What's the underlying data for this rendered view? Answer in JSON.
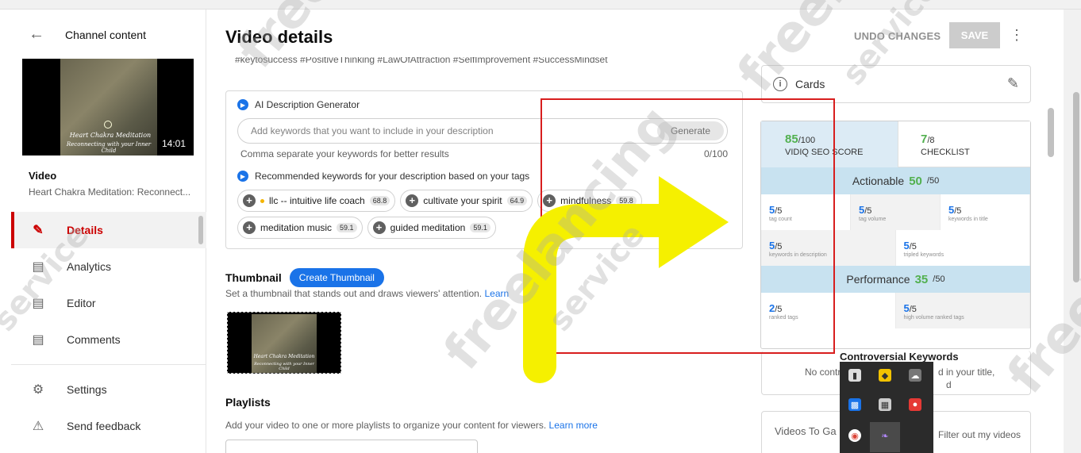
{
  "sidebar": {
    "header": "Channel content",
    "thumbnail": {
      "duration": "14:01",
      "line1": "Heart Chakra Meditation",
      "line2": "Reconnecting with your Inner Child"
    },
    "video_label": "Video",
    "video_title": "Heart Chakra Meditation: Reconnect...",
    "nav": [
      {
        "label": "Details",
        "icon": "pencil-icon"
      },
      {
        "label": "Analytics",
        "icon": "analytics-icon"
      },
      {
        "label": "Editor",
        "icon": "editor-icon"
      },
      {
        "label": "Comments",
        "icon": "comments-icon"
      },
      {
        "label": "Settings",
        "icon": "gear-icon"
      },
      {
        "label": "Send feedback",
        "icon": "feedback-icon"
      }
    ]
  },
  "main": {
    "title": "Video details",
    "undo_label": "UNDO CHANGES",
    "save_label": "SAVE",
    "desc_tail": "#keytosuccess #PositiveThinking #LawOfAttraction #SelfImprovement #SuccessMindset",
    "ai": {
      "title": "AI Description Generator",
      "placeholder": "Add keywords that you want to include in your description",
      "generate_label": "Generate",
      "hint": "Comma separate your keywords for better results",
      "counter": "0/100",
      "rec_title": "Recommended keywords for your description based on your tags",
      "chips": [
        {
          "label": "llc -- intuitive life coach",
          "score": "68.8"
        },
        {
          "label": "cultivate your spirit",
          "score": "64.9"
        },
        {
          "label": "mindfulness",
          "score": "59.8"
        },
        {
          "label": "meditation music",
          "score": "59.1"
        },
        {
          "label": "guided meditation",
          "score": "59.1"
        }
      ]
    },
    "thumbnail": {
      "title": "Thumbnail",
      "create_label": "Create Thumbnail",
      "desc": "Set a thumbnail that stands out and draws viewers' attention.",
      "learn": "Learn"
    },
    "playlists": {
      "title": "Playlists",
      "desc": "Add your video to one or more playlists to organize your content for viewers.",
      "learn": "Learn more"
    }
  },
  "right": {
    "cards_label": "Cards",
    "vidiq": {
      "seo_score": "85",
      "seo_den": "/100",
      "seo_label": "VIDIQ SEO SCORE",
      "checklist_score": "7",
      "checklist_den": "/8",
      "checklist_label": "CHECKLIST",
      "actionable_label": "Actionable",
      "actionable_score": "50",
      "actionable_den": "/50",
      "actionable_items": [
        {
          "score": "5",
          "den": "/5",
          "label": "tag count"
        },
        {
          "score": "5",
          "den": "/5",
          "label": "tag volume"
        },
        {
          "score": "5",
          "den": "/5",
          "label": "keywords in title"
        },
        {
          "score": "5",
          "den": "/5",
          "label": "keywords in description"
        },
        {
          "score": "5",
          "den": "/5",
          "label": "tripled keywords"
        }
      ],
      "performance_label": "Performance",
      "performance_score": "35",
      "performance_den": "/50",
      "performance_items": [
        {
          "score": "2",
          "den": "/5",
          "label": "ranked tags"
        },
        {
          "score": "5",
          "den": "/5",
          "label": "high volume ranked tags"
        }
      ]
    },
    "controversial": {
      "title": "Controversial Keywords",
      "left": "No contr",
      "right": "d in your title,",
      "right2": "d"
    },
    "videos_to_gain": {
      "label": "Videos To Ga",
      "filter": "Filter out my videos"
    }
  },
  "watermark": {
    "text1": "freelancing",
    "text2": "service"
  },
  "colors": {
    "accent_red": "#cc0000",
    "vidiq_green": "#52b04f",
    "link_blue": "#1a73e8",
    "highlight_red": "#d81e1e",
    "arrow_yellow": "#f5f000"
  }
}
